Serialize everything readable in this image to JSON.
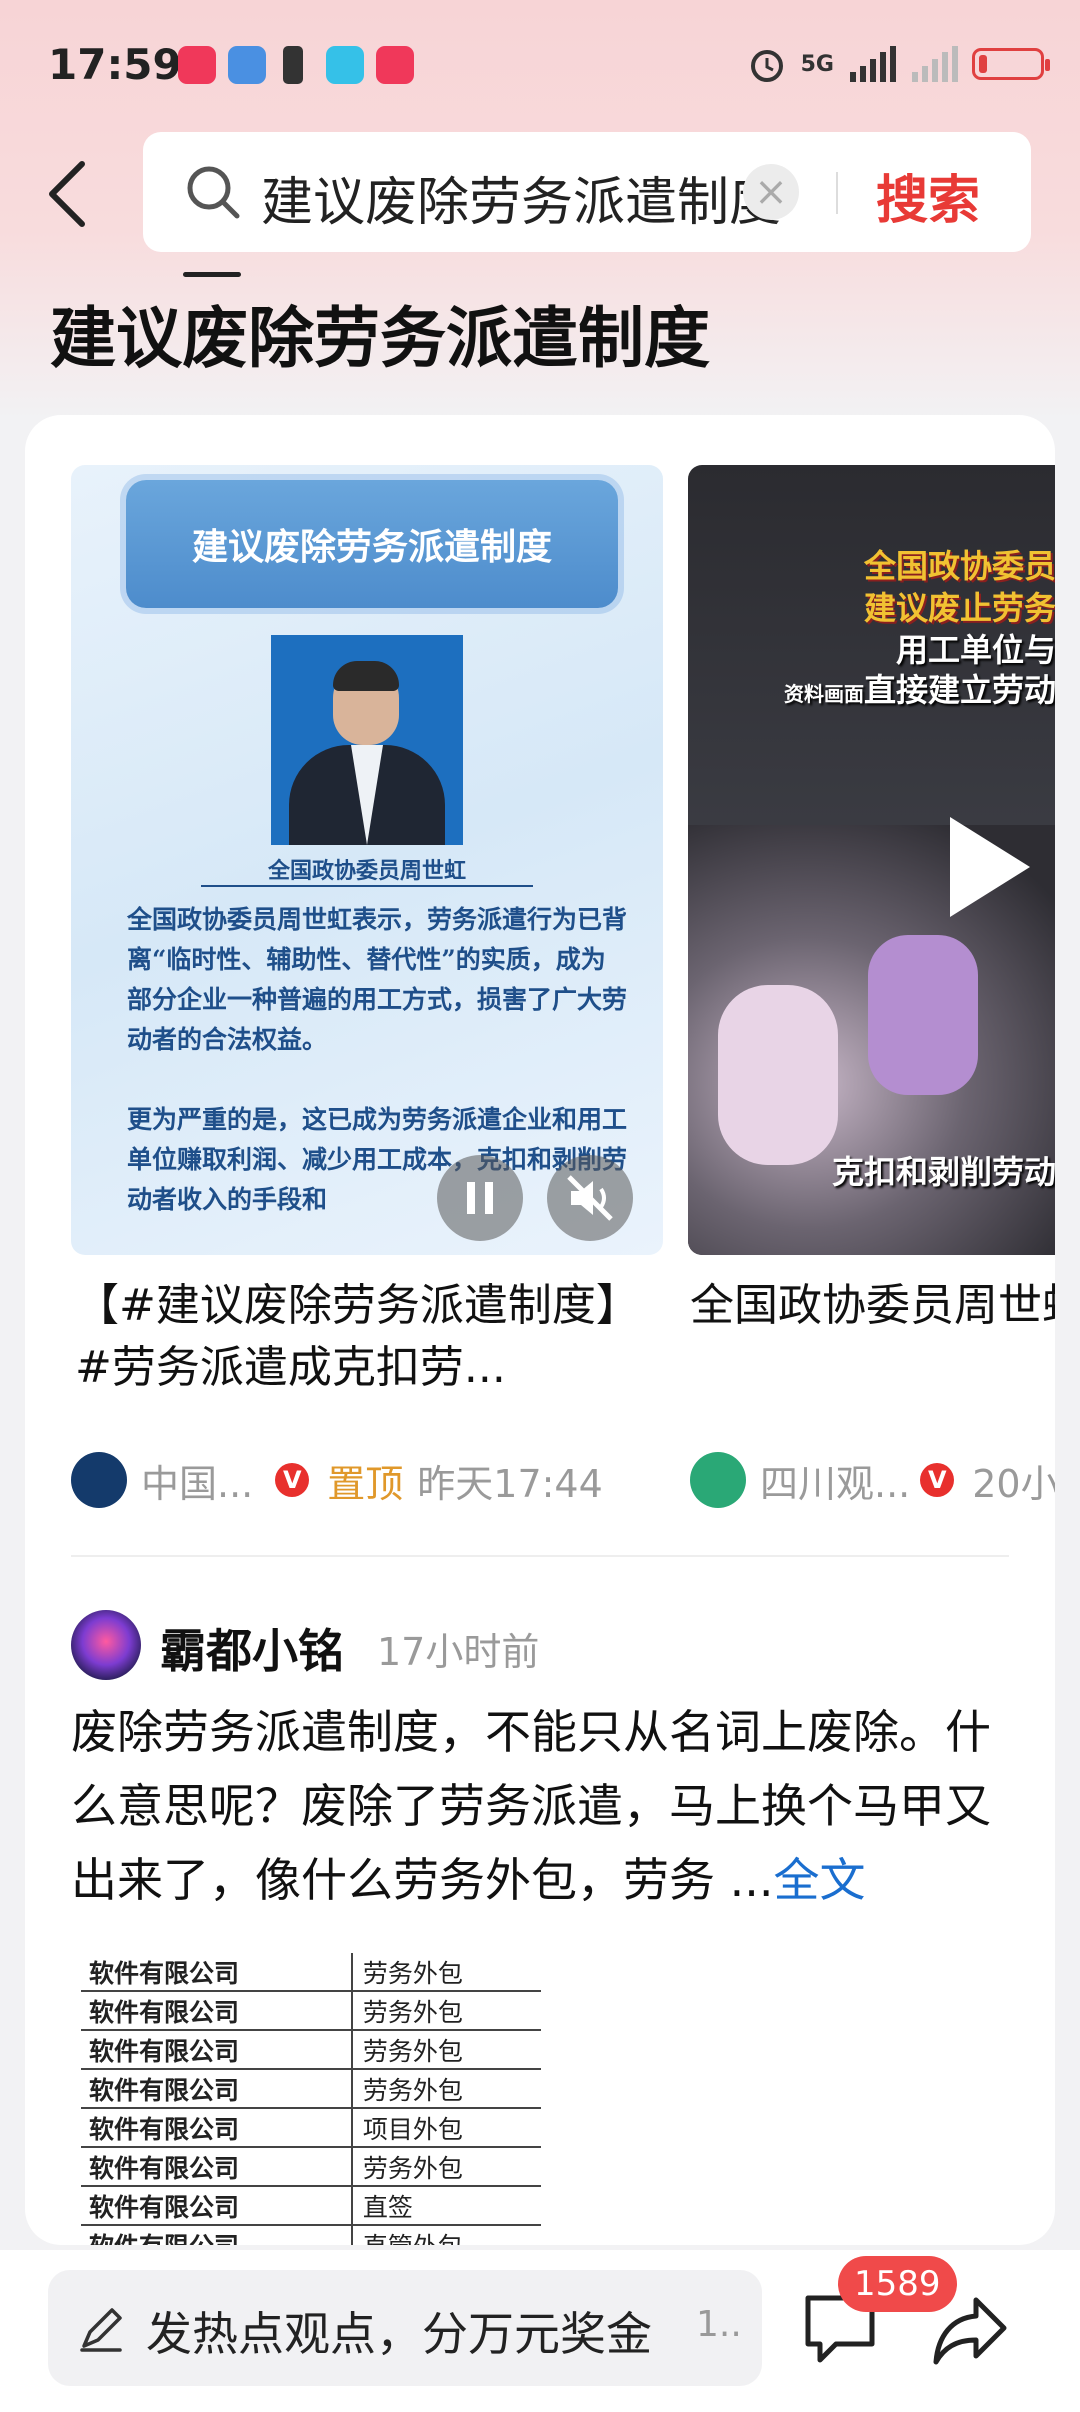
{
  "status_bar": {
    "time": "17:59",
    "network": "5G",
    "colors": {
      "battery_low": "#e04040"
    }
  },
  "search": {
    "query": "建议废除劳务派遣制度",
    "search_button": "搜索",
    "clear_icon": "×"
  },
  "topic": {
    "title": "建议废除劳务派遣制度"
  },
  "videos": [
    {
      "banner_text": "建议废除劳务派遣制度",
      "person_caption": "全国政协委员周世虹",
      "paragraphs": [
        "全国政协委员周世虹表示，劳务派遣行为已背离“临时性、辅助性、替代性”的实质，成为部分企业一种普遍的用工方式，损害了广大劳动者的合法权益。",
        "更为严重的是，这已成为劳务派遣企业和用工单位赚取利润、减少用工成本，克扣和剥削劳动者收入的手段和"
      ],
      "title": "【#建议废除劳务派遣制度】#劳务派遣成克扣劳...",
      "source": "中国...",
      "pinned": "置顶",
      "time": "昨天17:44"
    },
    {
      "overlay_lines": [
        "全国政协委员周",
        "建议废止劳务派",
        "用工单位与劳",
        "直接建立劳动合",
        "克扣和剥削劳动者"
      ],
      "overlay_small": "资料画面",
      "title": "全国政协委员周世虹建议废止劳务派遣制度",
      "source": "四川观...",
      "time": "20小"
    }
  ],
  "post": {
    "username": "霸都小铭",
    "time": "17小时前",
    "body": "废除劳务派遣制度，不能只从名词上废除。什么意思呢？废除了劳务派遣，马上换个马甲又出来了，像什么劳务外包，劳务 ...",
    "full_text_label": "全文",
    "table": [
      [
        "软件有限公司",
        "劳务外包"
      ],
      [
        "软件有限公司",
        "劳务外包"
      ],
      [
        "软件有限公司",
        "劳务外包"
      ],
      [
        "软件有限公司",
        "劳务外包"
      ],
      [
        "软件有限公司",
        "项目外包"
      ],
      [
        "软件有限公司",
        "劳务外包"
      ],
      [
        "软件有限公司",
        "直签"
      ],
      [
        "软件有限公司",
        "直管外包"
      ]
    ]
  },
  "bottom_bar": {
    "comment_placeholder": "发热点观点，分万元奖金",
    "comment_more": "1..",
    "comment_count": "1589"
  },
  "icons": [
    "back-arrow-icon",
    "search-icon",
    "clear-icon",
    "pause-icon",
    "mute-icon",
    "play-icon",
    "verified-icon",
    "pen-icon",
    "comment-icon",
    "share-icon"
  ],
  "colors": {
    "accent_red": "#e83a36",
    "link_blue": "#1a6ecf",
    "pinned": "#e0982a"
  }
}
